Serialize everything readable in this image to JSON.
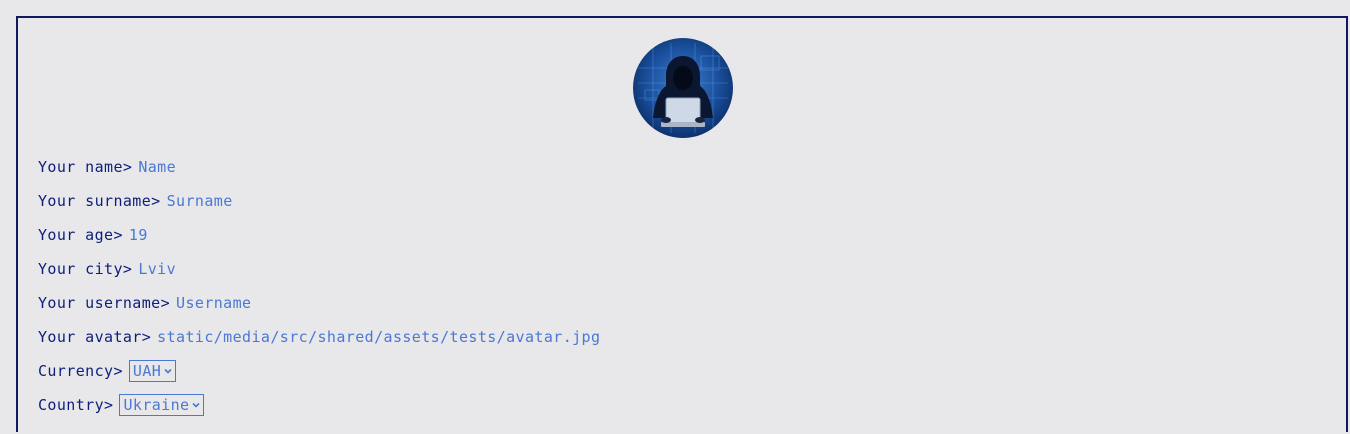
{
  "profile": {
    "avatar_icon": "hooded-hacker-avatar",
    "fields": [
      {
        "label": "Your name>",
        "value": "Name"
      },
      {
        "label": "Your surname>",
        "value": "Surname"
      },
      {
        "label": "Your age>",
        "value": "19"
      },
      {
        "label": "Your city>",
        "value": "Lviv"
      },
      {
        "label": "Your username>",
        "value": "Username"
      },
      {
        "label": "Your avatar>",
        "value": "static/media/src/shared/assets/tests/avatar.jpg"
      }
    ],
    "currency": {
      "label": "Currency>",
      "selected": "UAH"
    },
    "country": {
      "label": "Country>",
      "selected": "Ukraine"
    }
  },
  "colors": {
    "label": "#0c1e7a",
    "value": "#4a78d4",
    "border": "#0f1a5c",
    "background": "#e8e8ea"
  }
}
